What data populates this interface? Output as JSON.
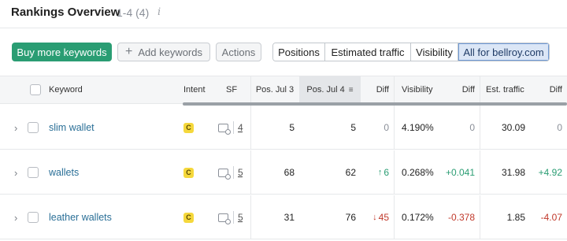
{
  "header": {
    "title": "Rankings Overview",
    "count": "1-4 (4)",
    "info_icon": "i"
  },
  "toolbar": {
    "buy_label": "Buy more keywords",
    "add_label": "Add keywords",
    "add_icon": "+",
    "actions_label": "Actions",
    "tabs": [
      {
        "label": "Positions"
      },
      {
        "label": "Estimated traffic"
      },
      {
        "label": "Visibility"
      },
      {
        "label": "All for bellroy.com"
      }
    ],
    "active_tab": "All for bellroy.com"
  },
  "table": {
    "columns": {
      "keyword": "Keyword",
      "intent": "Intent",
      "sf": "SF",
      "pos_jul3": "Pos. Jul 3",
      "pos_jul4": "Pos. Jul 4",
      "diff1": "Diff",
      "visibility": "Visibility",
      "diff2": "Diff",
      "est_traffic": "Est. traffic",
      "diff3": "Diff"
    },
    "sort_icon": "≡",
    "rows": [
      {
        "keyword": "slim wallet",
        "intent": "C",
        "sf": "4",
        "pos_jul3": "5",
        "pos_jul4": "5",
        "pos_diff": "0",
        "pos_diff_dir": "zero",
        "visibility": "4.190%",
        "vis_diff": "0",
        "vis_diff_dir": "zero",
        "traffic": "30.09",
        "traffic_diff": "0",
        "traffic_diff_dir": "zero"
      },
      {
        "keyword": "wallets",
        "intent": "C",
        "sf": "5",
        "pos_jul3": "68",
        "pos_jul4": "62",
        "pos_diff": "6",
        "pos_diff_arrow": "↑",
        "pos_diff_dir": "up",
        "visibility": "0.268%",
        "vis_diff": "+0.041",
        "vis_diff_dir": "up",
        "traffic": "31.98",
        "traffic_diff": "+4.92",
        "traffic_diff_dir": "up"
      },
      {
        "keyword": "leather wallets",
        "intent": "C",
        "sf": "5",
        "pos_jul3": "31",
        "pos_jul4": "76",
        "pos_diff": "45",
        "pos_diff_arrow": "↓",
        "pos_diff_dir": "down",
        "visibility": "0.172%",
        "vis_diff": "-0.378",
        "vis_diff_dir": "down",
        "traffic": "1.85",
        "traffic_diff": "-4.07",
        "traffic_diff_dir": "down"
      }
    ]
  },
  "colors": {
    "primary": "#2a9d73",
    "active_tab_bg": "#dbe6f6",
    "intent_commercial": "#f5d83c",
    "positive": "#2a9d73",
    "negative": "#c0392b"
  }
}
